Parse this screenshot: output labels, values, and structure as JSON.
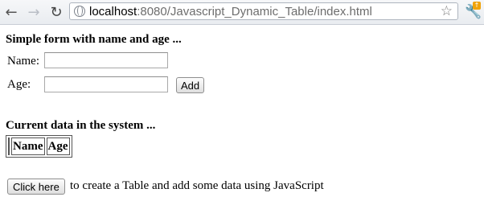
{
  "browser": {
    "url_host": "localhost",
    "url_rest": ":8080/Javascript_Dynamic_Table/index.html"
  },
  "form": {
    "heading": "Simple form with name and age ...",
    "name_label": "Name:",
    "name_value": "",
    "age_label": "Age:",
    "age_value": "",
    "add_button": "Add"
  },
  "data_section": {
    "heading": "Current data in the system ...",
    "columns": [
      "",
      "Name",
      "Age"
    ]
  },
  "footer": {
    "button": "Click here",
    "text": "to create a Table and add some data using JavaScript"
  }
}
